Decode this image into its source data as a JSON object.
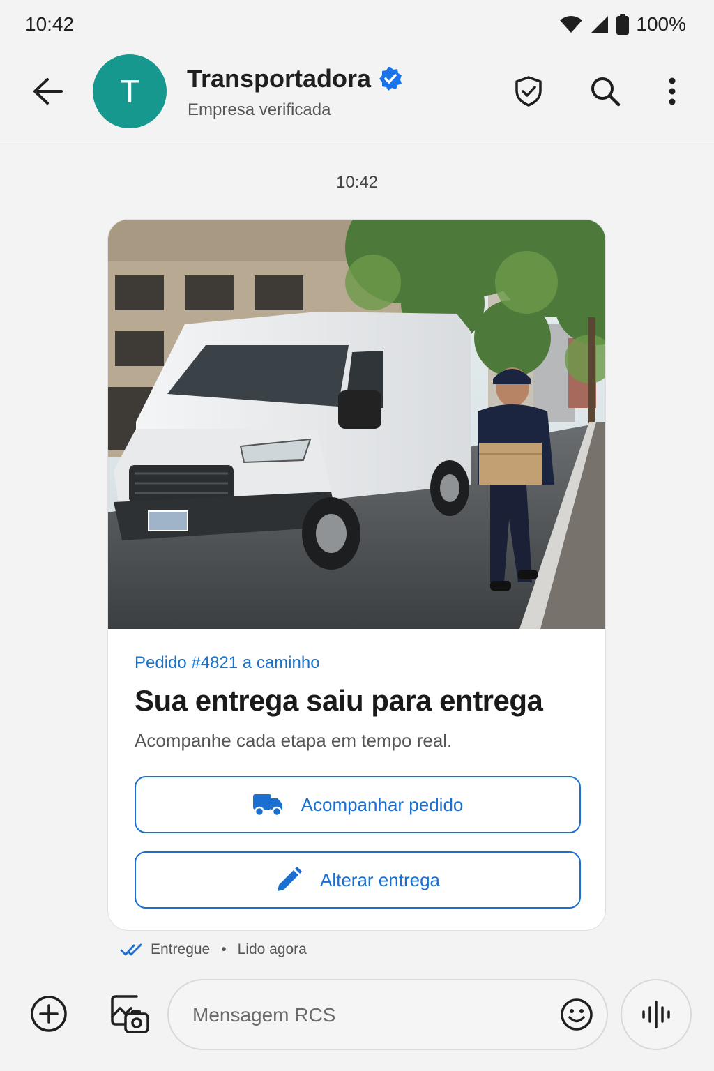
{
  "status_bar": {
    "time": "10:42",
    "battery": "100%",
    "icons": [
      "wifi-icon",
      "signal-icon",
      "battery-icon"
    ]
  },
  "header": {
    "contact_name": "Transportadora",
    "contact_subtitle": "Empresa verificada",
    "avatar_letter": "T",
    "avatar_color": "#16988f",
    "verified_icon": "verified-badge-icon",
    "actions": [
      "back-arrow-icon",
      "shield-check-icon",
      "search-icon",
      "more-vert-icon"
    ]
  },
  "conversation": {
    "timestamp": "10:42",
    "card": {
      "image_icon": "delivery-van-photo",
      "eyebrow": "Pedido #4821 a caminho",
      "title": "Sua entrega saiu para entrega",
      "description": "Acompanhe cada etapa em tempo real.",
      "buttons": [
        {
          "label": "Acompanhar pedido",
          "icon": "truck-icon"
        },
        {
          "label": "Alterar entrega",
          "icon": "pencil-icon"
        }
      ],
      "accent_color": "#1a6fd0"
    },
    "receipt": {
      "status": "Entregue",
      "read": "Lido agora",
      "separator": "•"
    }
  },
  "compose": {
    "placeholder": "Mensagem RCS",
    "icons": [
      "add-circle-icon",
      "gallery-icon",
      "emoji-icon",
      "voice-icon"
    ]
  }
}
